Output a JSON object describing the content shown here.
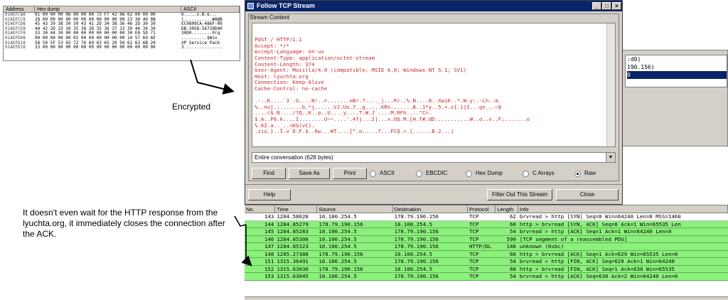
{
  "hex_view": {
    "headers": [
      "Address",
      "Hex dump",
      "ASCII"
    ],
    "rows": [
      {
        "addr": "01AEFCB8",
        "bytes": "01 00 00 00 06 00 00 00 73 F7 42 06 02 00 00 00",
        "ascii": "O.....s.B.e..."
      },
      {
        "addr": "01AEFCC8",
        "bytes": "28 00 00 00 00 00 00 00 00 00 00 00 23 38 40 8B",
        "ascii": "(...........#8@B"
      },
      {
        "addr": "01AEFCD8",
        "bytes": "45 43 39 38 30 39 43 41 2D 34 38 36 46 2D 30 39",
        "ascii": "EC9809CA-486F-09"
      },
      {
        "addr": "01AEFCE8",
        "bytes": "44 42 2D 33 30 35 38 2D 35 36 37 33 39 44 34 30",
        "ascii": "DB-3058-56739D40"
      },
      {
        "addr": "01AEFCF8",
        "bytes": "33 30 44 30 00 00 00 00 00 00 00 00 30 E8 5D 71",
        "ascii": "30D0........0(q"
      },
      {
        "addr": "01AEFD08",
        "bytes": "00 00 00 00 00 01 00 00 00 00 00 00 14 57 69 6E",
        "ascii": "..........$Win"
      },
      {
        "addr": "01AEFD18",
        "bytes": "58 50 5F 53 65 72 76 69 63 65 20 50 61 63 6B 20",
        "ascii": "XP_Service Pack "
      },
      {
        "addr": "01AEFD28",
        "bytes": "33 00 00 00 00 00 00 00 00 00 00 00 00 00 00 00",
        "ascii": "3..............."
      }
    ]
  },
  "notes": {
    "encrypted": "Encrypted",
    "ack": "It doesn't even wait for the HTTP response from the lyuchta.org, it immediately closes the connection after the ACK."
  },
  "background_panel": {
    "lines": [
      ":d0)",
      "190.156)",
      "0"
    ]
  },
  "dialog": {
    "title": "Follow TCP Stream",
    "group_label": "Stream Content",
    "stream_lines": [
      "POST / HTTP/1.1",
      "Accept: */*",
      "Accept-Language: en-us",
      "Content-Type: application/octet-stream",
      "Content-Length: 374",
      "User-Agent: Mozilla/4.0 (compatible; MSIE 6.0; Windows NT 5.1; SV1)",
      "Host: lyuchta.org",
      "Connection: Keep-Alive",
      "Cache-Control: no-cache",
      "",
      ".-..K....`3`.G....N!..=.......oBr.?...._|...Rr..%.N....8..XwiK..*.W.y:.-Lh..m.",
      "%..nuj.;.......b.*j......VJ.Uo.7..g.....KRn.......B..1*y..5.+.z{.}jI...gn_..~@",
      "....c$.N..../?Q..K..p..U....y....T.W.J`....M.RFh....\"C=.",
      "$.A..P6.k....I........U~~....'.4fj...2|...x.OQ.M.[H.f#.dD...........W..o..v..F;.......o",
      "%.6Z.a.._..<KG(vC).",
      ".ziu.}..I.v`D.F.$..6w...WT....[\".o.....7...FCQ.>.{......B.2...|"
    ],
    "dropdown_value": "Entire conversation (628 bytes)",
    "buttons": {
      "find": "Find",
      "save_as": "Save As",
      "print": "Print",
      "help": "Help",
      "filter_out": "Filter Out This Stream",
      "close": "Close"
    },
    "radios": [
      "ASCII",
      "EBCDIC",
      "Hex Dump",
      "C Arrays",
      "Raw"
    ],
    "selected_radio": "Raw"
  },
  "packet_list": {
    "headers": [
      "No.",
      "Time",
      "Source",
      "Destination",
      "Protocol",
      "Length",
      "Info"
    ],
    "rows": [
      {
        "no": "143",
        "time": "1284.58628",
        "src": "10.100.254.5",
        "dst": "178.79.190.156",
        "proto": "TCP",
        "len": "62",
        "info": "brvread > http [SYN] Seq=0 Win=64240 Len=0 MSS=1460"
      },
      {
        "no": "144",
        "time": "1284.85279",
        "src": "178.79.190.156",
        "dst": "10.100.254.5",
        "proto": "TCP",
        "len": "60",
        "info": "http > brvread [SYN, ACK] Seq=0 Ack=1 Win=65535 Len"
      },
      {
        "no": "145",
        "time": "1284.85283",
        "src": "10.100.254.5",
        "dst": "178.79.190.156",
        "proto": "TCP",
        "len": "54",
        "info": "brvread > http [ACK] Seq=1 Ack=1 Win=64240 Len=0"
      },
      {
        "no": "146",
        "time": "1284.85308",
        "src": "10.100.254.5",
        "dst": "178.79.190.156",
        "proto": "TCP",
        "len": "590",
        "info": "[TCP segment of a reassembled PDU]"
      },
      {
        "no": "147",
        "time": "1284.85323",
        "src": "10.100.254.5",
        "dst": "178.79.190.156",
        "proto": "HTTP/DL",
        "len": "146",
        "info": "unknown (0xbc)"
      },
      {
        "no": "148",
        "time": "1285.27388",
        "src": "178.79.190.156",
        "dst": "10.100.254.5",
        "proto": "TCP",
        "len": "60",
        "info": "http > brvread [ACK] Seq=1 Ack=629 Win=65535 Len=0"
      },
      {
        "no": "151",
        "time": "1315.36491",
        "src": "10.100.254.5",
        "dst": "178.79.190.156",
        "proto": "TCP",
        "len": "54",
        "info": "brvread > http [FIN, ACK] Seq=629 Ack=1 Win=64240"
      },
      {
        "no": "152",
        "time": "1315.63030",
        "src": "178.79.190.156",
        "dst": "10.100.254.5",
        "proto": "TCP",
        "len": "60",
        "info": "http > brvread [FIN, ACK] Seq=1 Ack=630 Win=65535"
      },
      {
        "no": "153",
        "time": "1315.63045",
        "src": "10.100.254.5",
        "dst": "178.79.190.156",
        "proto": "TCP",
        "len": "54",
        "info": "brvread > http [ACK] Seq=630 Ack=2 Win=64240 Len=0"
      }
    ]
  }
}
